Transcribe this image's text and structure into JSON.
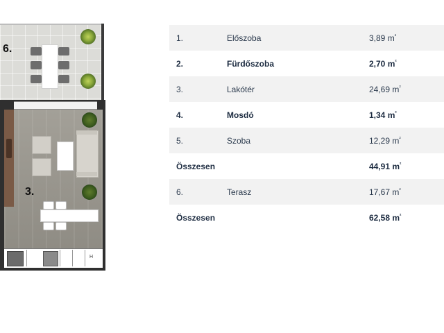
{
  "plan": {
    "room_labels": {
      "terrace": "6.",
      "living": "3."
    },
    "appliance_label": "H"
  },
  "areas": {
    "unit": "m²",
    "rows": [
      {
        "num": "1.",
        "name": "Előszoba",
        "area": "3,89 m"
      },
      {
        "num": "2.",
        "name": "Fürdőszoba",
        "area": "2,70 m"
      },
      {
        "num": "3.",
        "name": "Lakótér",
        "area": "24,69 m"
      },
      {
        "num": "4.",
        "name": "Mosdó",
        "area": "1,34 m"
      },
      {
        "num": "5.",
        "name": "Szoba",
        "area": "12,29 m"
      },
      {
        "num": "Összesen",
        "name": "",
        "area": "44,91 m"
      },
      {
        "num": "6.",
        "name": "Terasz",
        "area": "17,67 m"
      },
      {
        "num": "Összesen",
        "name": "",
        "area": "62,58 m"
      }
    ],
    "superscript": "²"
  }
}
